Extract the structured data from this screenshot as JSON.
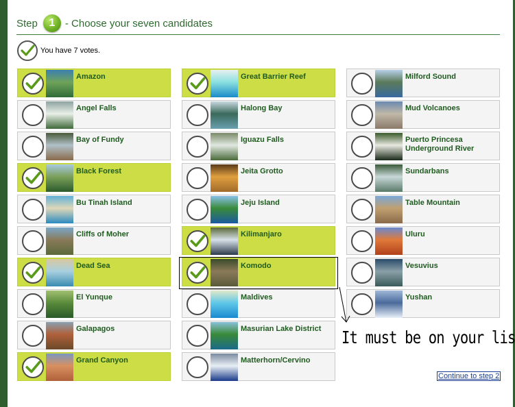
{
  "header": {
    "step_label": "Step",
    "step_number": "1",
    "title": "- Choose your seven candidates"
  },
  "votes": {
    "text": "You have 7 votes."
  },
  "candidates": [
    {
      "name": "Amazon",
      "selected": true,
      "thumb": "forest-river"
    },
    {
      "name": "Angel Falls",
      "selected": false,
      "thumb": "waterfall"
    },
    {
      "name": "Bay of Fundy",
      "selected": false,
      "thumb": "rock-coast"
    },
    {
      "name": "Black Forest",
      "selected": true,
      "thumb": "forest-hills"
    },
    {
      "name": "Bu Tinah Island",
      "selected": false,
      "thumb": "island"
    },
    {
      "name": "Cliffs of Moher",
      "selected": false,
      "thumb": "cliffs"
    },
    {
      "name": "Dead Sea",
      "selected": true,
      "thumb": "sea"
    },
    {
      "name": "El Yunque",
      "selected": false,
      "thumb": "jungle"
    },
    {
      "name": "Galapagos",
      "selected": false,
      "thumb": "iguana"
    },
    {
      "name": "Grand Canyon",
      "selected": true,
      "thumb": "canyon"
    },
    {
      "name": "Great Barrier Reef",
      "selected": true,
      "thumb": "reef"
    },
    {
      "name": "Halong Bay",
      "selected": false,
      "thumb": "bay"
    },
    {
      "name": "Iguazu Falls",
      "selected": false,
      "thumb": "falls"
    },
    {
      "name": "Jeita Grotto",
      "selected": false,
      "thumb": "grotto"
    },
    {
      "name": "Jeju Island",
      "selected": false,
      "thumb": "island-blue"
    },
    {
      "name": "Kilimanjaro",
      "selected": true,
      "thumb": "mountain"
    },
    {
      "name": "Komodo",
      "selected": true,
      "thumb": "lizard"
    },
    {
      "name": "Maldives",
      "selected": false,
      "thumb": "lagoon"
    },
    {
      "name": "Masurian Lake District",
      "selected": false,
      "thumb": "lake"
    },
    {
      "name": "Matterhorn/Cervino",
      "selected": false,
      "thumb": "peak"
    },
    {
      "name": "Milford Sound",
      "selected": false,
      "thumb": "fjord"
    },
    {
      "name": "Mud Volcanoes",
      "selected": false,
      "thumb": "mud"
    },
    {
      "name": "Puerto Princesa Underground River",
      "selected": false,
      "thumb": "cave"
    },
    {
      "name": "Sundarbans",
      "selected": false,
      "thumb": "mangrove"
    },
    {
      "name": "Table Mountain",
      "selected": false,
      "thumb": "mesa"
    },
    {
      "name": "Uluru",
      "selected": false,
      "thumb": "red-rock"
    },
    {
      "name": "Vesuvius",
      "selected": false,
      "thumb": "volcano"
    },
    {
      "name": "Yushan",
      "selected": false,
      "thumb": "snow-peak"
    }
  ],
  "annotation": {
    "text": "It must be on your list!"
  },
  "footer": {
    "continue_label": "Continue to step 2"
  },
  "colors": {
    "selected": "#cddd45",
    "unselected": "#f4f4f4",
    "accent": "#2e6a2e",
    "frame": "#2f5f2f"
  }
}
